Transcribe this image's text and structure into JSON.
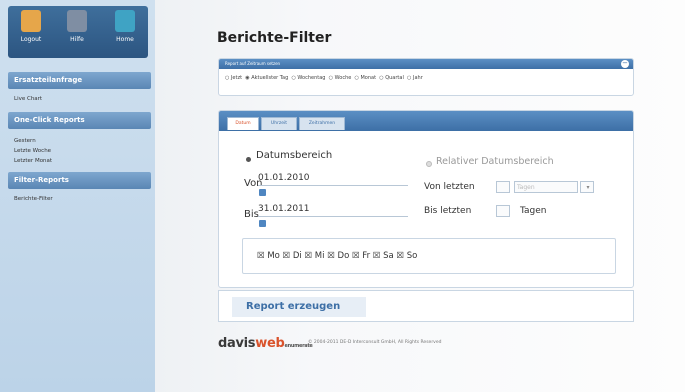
{
  "toolbar": {
    "items": [
      {
        "label": "Logout",
        "icon": "logout-person-icon",
        "color": "#e6a64a"
      },
      {
        "label": "Hilfe",
        "icon": "help-book-icon",
        "color": "#7f8ea3"
      },
      {
        "label": "Home",
        "icon": "home-icon",
        "color": "#3fa3c4"
      }
    ]
  },
  "sidebar": {
    "sections": [
      {
        "title": "Ersatzteilanfrage",
        "items": [
          "Live Chart"
        ]
      },
      {
        "title": "One-Click Reports",
        "items": [
          "Gestern",
          "Letzte Woche",
          "Letzter Monat"
        ]
      },
      {
        "title": "Filter-Reports",
        "items": [
          "Berichte-Filter"
        ]
      }
    ]
  },
  "page": {
    "title": "Berichte-Filter"
  },
  "range": {
    "header": "Report auf Zeitraum setzen",
    "options": [
      "Jetzt",
      "Aktuellster Tag",
      "Wochentag",
      "Woche",
      "Monat",
      "Quartal",
      "Jahr"
    ]
  },
  "filter": {
    "tabs": [
      "Datum",
      "Uhrzeit",
      "Zeitrahmen"
    ],
    "absolute_label": "Datumsbereich",
    "relative_label": "Relativer Datumsbereich",
    "from_label": "Von",
    "from_value": "01.01.2010",
    "to_label": "Bis",
    "to_value": "31.01.2011",
    "last_from_label": "Von letzten",
    "last_unit_select": "Tagen",
    "last_to_label": "Bis letzten",
    "last_unit": "Tagen",
    "days": "☒ Mo ☒ Di ☒ Mi ☒ Do ☒ Fr ☒ Sa ☒ So"
  },
  "action": {
    "report_button": "Report erzeugen"
  },
  "footer": {
    "brand_davis": "davis",
    "brand_web": "web",
    "brand_enum": "enumerate",
    "copyright": "© 2004-2011 DE-D Interconsult GmbH, All Rights Reserved"
  },
  "colors": {
    "accent": "#3d6fa6",
    "brand": "#d9532c",
    "sidebar_bg": "#cfe0ef"
  }
}
